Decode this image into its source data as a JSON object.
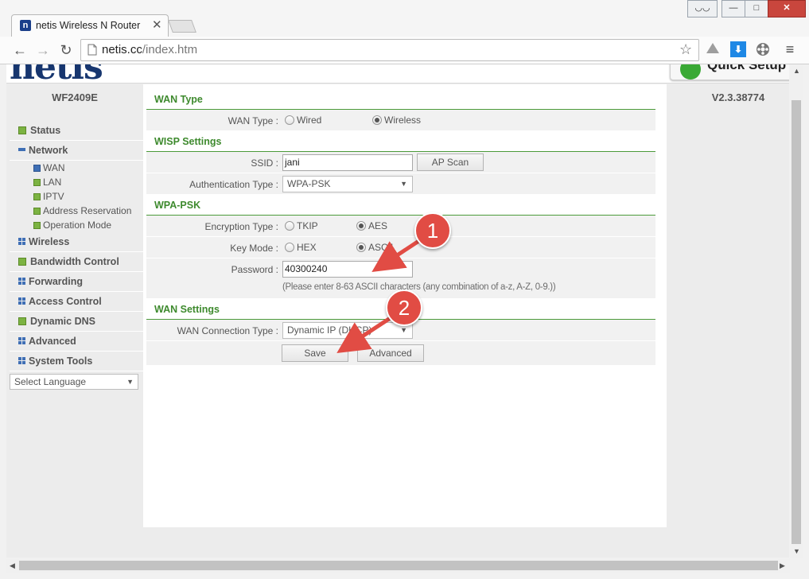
{
  "browser": {
    "tab_title": "netis Wireless N Router",
    "url_domain": "netis.cc",
    "url_path": "/index.htm",
    "window_buttons": {
      "minimize": "—",
      "restore": "□",
      "close": "✕"
    }
  },
  "header": {
    "logo_text": "netis",
    "quick_setup_label": "Quick Setup",
    "model": "WF2409E",
    "version": "V2.3.38774"
  },
  "sidebar": {
    "items": [
      {
        "label": "Status"
      },
      {
        "label": "Network"
      },
      {
        "label": "Wireless"
      },
      {
        "label": "Bandwidth Control"
      },
      {
        "label": "Forwarding"
      },
      {
        "label": "Access Control"
      },
      {
        "label": "Dynamic DNS"
      },
      {
        "label": "Advanced"
      },
      {
        "label": "System Tools"
      }
    ],
    "network_sub": [
      "WAN",
      "LAN",
      "IPTV",
      "Address Reservation",
      "Operation Mode"
    ],
    "language": "Select Language"
  },
  "wan_type": {
    "section_title": "WAN Type",
    "label": "WAN Type :",
    "options": [
      "Wired",
      "Wireless"
    ],
    "selected": "Wireless"
  },
  "wisp": {
    "section_title": "WISP Settings",
    "ssid_label": "SSID :",
    "ssid_value": "jani",
    "ap_scan": "AP Scan",
    "auth_label": "Authentication Type :",
    "auth_value": "WPA-PSK"
  },
  "wpa": {
    "section_title": "WPA-PSK",
    "enc_label": "Encryption Type :",
    "enc_options": [
      "TKIP",
      "AES"
    ],
    "enc_selected": "AES",
    "key_label": "Key Mode :",
    "key_options": [
      "HEX",
      "ASCII"
    ],
    "key_selected": "ASCII",
    "password_label": "Password :",
    "password_value": "40300240",
    "hint": "(Please enter 8-63 ASCII characters (any combination of a-z, A-Z, 0-9.))"
  },
  "wan_settings": {
    "section_title": "WAN Settings",
    "conn_label": "WAN Connection Type :",
    "conn_value": "Dynamic IP (DHCP)",
    "save": "Save",
    "advanced": "Advanced"
  },
  "annotations": {
    "callout1": "1",
    "callout2": "2"
  }
}
